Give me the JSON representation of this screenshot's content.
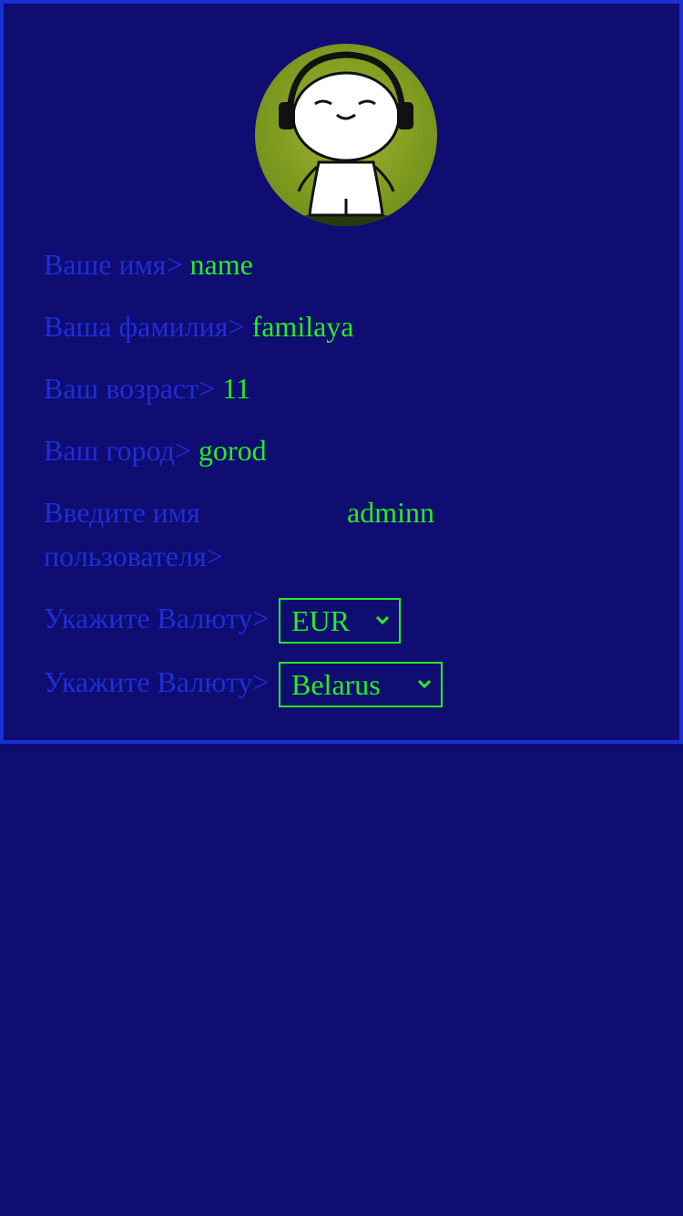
{
  "profile": {
    "name_label": "Ваше имя>",
    "name_value": "name",
    "surname_label": "Ваша фамилия>",
    "surname_value": "familaya",
    "age_label": "Ваш возраст>",
    "age_value": "11",
    "city_label": "Ваш город>",
    "city_value": "gorod",
    "username_label": "Введите имя пользователя>",
    "username_value": "adminn"
  },
  "currency": {
    "label": "Укажите Валюту>",
    "selected": "EUR"
  },
  "country": {
    "label": "Укажите Валюту>",
    "selected": "Belarus"
  },
  "colors": {
    "background": "#0f0c72",
    "border": "#1b2fd6",
    "label": "#1d2fd8",
    "value": "#22f01e"
  },
  "icons": {
    "avatar": "cartoon-character-with-headphones",
    "dropdown": "chevron-down-icon"
  }
}
